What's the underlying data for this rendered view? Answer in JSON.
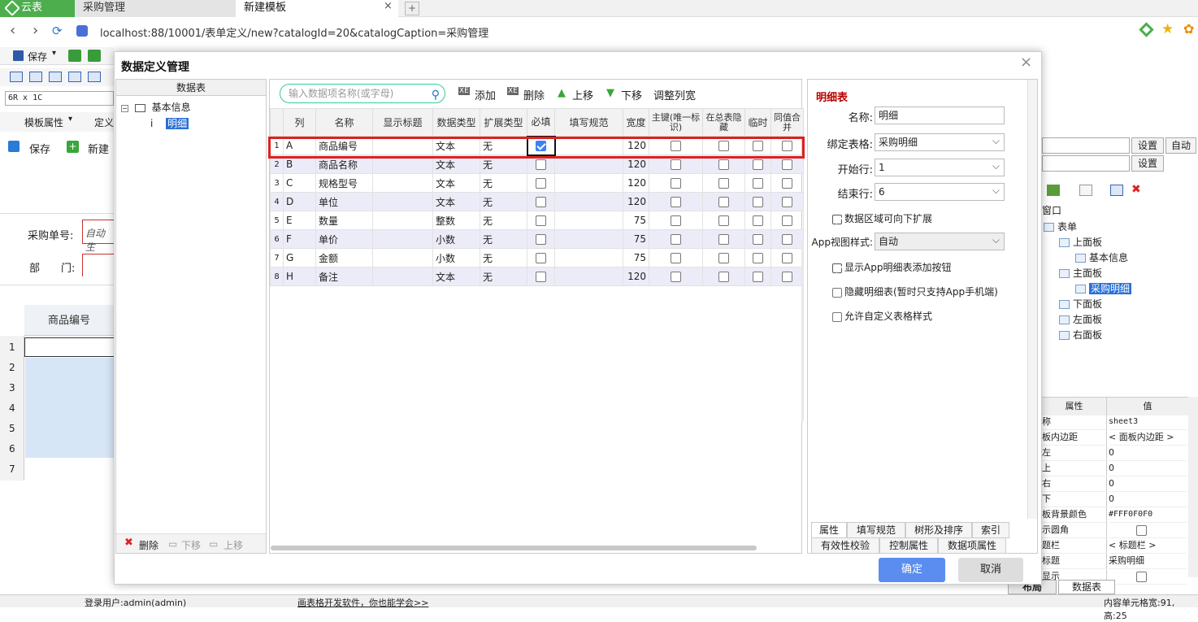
{
  "browser": {
    "tabs": [
      {
        "label": "云表"
      },
      {
        "label": "采购管理"
      },
      {
        "label": "新建模板"
      }
    ],
    "tab_close": "×",
    "url": "localhost:88/10001/表单定义/new?catalogId=20&catalogCaption=采购管理"
  },
  "bg": {
    "save_label": "保存",
    "cell_ref": "6R x 1C",
    "template_attr": "模板属性",
    "define": "定义",
    "save2": "保存",
    "new": "新建",
    "order_no_label": "采购单号:",
    "order_no_value": "自动生",
    "dept_label": "部　　门:",
    "column_header": "商品编号",
    "rows": [
      "1",
      "2",
      "3",
      "4",
      "5",
      "6",
      "7"
    ],
    "set1": "设置",
    "auto": "自动",
    "set2": "设置",
    "tree": {
      "window": "窗口",
      "form": "表单",
      "top": "上面板",
      "basic": "基本信息",
      "main": "主面板",
      "detail": "采购明细",
      "bottom": "下面板",
      "left": "左面板",
      "right": "右面板"
    },
    "props": {
      "head_name": "属性",
      "head_value": "值",
      "rows": [
        [
          "称",
          "sheet3"
        ],
        [
          "板内边距",
          "< 面板内边距 >"
        ],
        [
          "左",
          "0"
        ],
        [
          "上",
          "0"
        ],
        [
          "右",
          "0"
        ],
        [
          "下",
          "0"
        ],
        [
          "板背景颜色",
          "#FFF0F0F0"
        ],
        [
          "示圆角",
          ""
        ],
        [
          "题栏",
          "< 标题栏 >"
        ],
        [
          "标题",
          "采购明细"
        ],
        [
          "显示",
          ""
        ]
      ]
    },
    "tab_datatable": "数据表",
    "tab_layout": "布局",
    "status_user": "登录用户:admin(admin)",
    "status_ad": "画表格开发软件，你也能学会>>",
    "status_right": "内容单元格宽:91, 高:25"
  },
  "dialog": {
    "title": "数据定义管理",
    "close": "×",
    "tree": {
      "header": "数据表",
      "root": "基本信息",
      "child": "明细",
      "delete": "删除",
      "down": "下移",
      "up": "上移"
    },
    "toolbar": {
      "search_placeholder": "输入数据项名称(或字母)",
      "add": "添加",
      "delete": "删除",
      "up": "上移",
      "down": "下移",
      "adjust": "调整列宽"
    },
    "grid": {
      "headers": [
        "列",
        "名称",
        "显示标题",
        "数据类型",
        "扩展类型",
        "必填",
        "填写规范",
        "宽度",
        "主键(唯一标识)",
        "在总表隐藏",
        "临时",
        "同值合并"
      ],
      "rows": [
        {
          "n": "1",
          "col": "A",
          "name": "商品编号",
          "type": "文本",
          "ext": "无",
          "width": "120",
          "required": true
        },
        {
          "n": "2",
          "col": "B",
          "name": "商品名称",
          "type": "文本",
          "ext": "无",
          "width": "120",
          "required": false
        },
        {
          "n": "3",
          "col": "C",
          "name": "规格型号",
          "type": "文本",
          "ext": "无",
          "width": "120",
          "required": false
        },
        {
          "n": "4",
          "col": "D",
          "name": "单位",
          "type": "文本",
          "ext": "无",
          "width": "120",
          "required": false
        },
        {
          "n": "5",
          "col": "E",
          "name": "数量",
          "type": "整数",
          "ext": "无",
          "width": "75",
          "required": false
        },
        {
          "n": "6",
          "col": "F",
          "name": "单价",
          "type": "小数",
          "ext": "无",
          "width": "75",
          "required": false
        },
        {
          "n": "7",
          "col": "G",
          "name": "金额",
          "type": "小数",
          "ext": "无",
          "width": "75",
          "required": false
        },
        {
          "n": "8",
          "col": "H",
          "name": "备注",
          "type": "文本",
          "ext": "无",
          "width": "120",
          "required": false
        }
      ]
    },
    "props": {
      "title": "明细表",
      "name_label": "名称:",
      "name_value": "明细",
      "bind_label": "绑定表格:",
      "bind_value": "采购明细",
      "start_label": "开始行:",
      "start_value": "1",
      "end_label": "结束行:",
      "end_value": "6",
      "expand": "数据区域可向下扩展",
      "appview_label": "App视图样式:",
      "appview_value": "自动",
      "show_add": "显示App明细表添加按钮",
      "hide_detail": "隐藏明细表(暂时只支持App手机端)",
      "custom_style": "允许自定义表格样式",
      "tabs": [
        "属性",
        "填写规范",
        "树形及排序",
        "索引",
        "有效性校验",
        "控制属性",
        "数据项属性"
      ]
    },
    "ok": "确定",
    "cancel": "取消"
  }
}
